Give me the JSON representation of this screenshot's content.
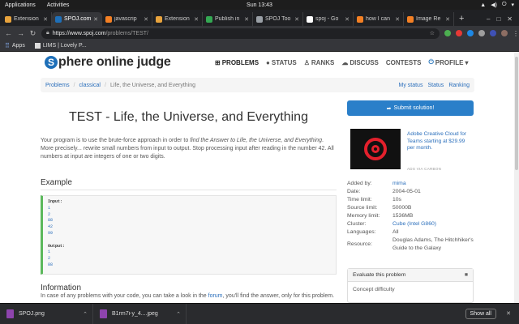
{
  "topbar": {
    "applications": "Applications",
    "activities": "Activities",
    "clock": "Sun 13:43"
  },
  "tabs": [
    {
      "title": "Extension",
      "color": "#e8a33d",
      "active": false
    },
    {
      "title": "SPOJ.com",
      "color": "#1e6fb8",
      "active": true
    },
    {
      "title": "javascrip",
      "color": "#f48024",
      "active": false
    },
    {
      "title": "Extension",
      "color": "#e8a33d",
      "active": false
    },
    {
      "title": "Publish in",
      "color": "#34a853",
      "active": false
    },
    {
      "title": "SPOJ Too",
      "color": "#9aa0a6",
      "active": false
    },
    {
      "title": "spoj - Go",
      "color": "#ffffff",
      "active": false
    },
    {
      "title": "how I can",
      "color": "#f48024",
      "active": false
    },
    {
      "title": "Image Re",
      "color": "#f48024",
      "active": false
    }
  ],
  "address": {
    "host": "https://www.spoj.com",
    "path": "/problems/TEST/"
  },
  "bookmarks": [
    {
      "label": "Apps",
      "icon": "apps-grid-icon"
    },
    {
      "label": "LIMS | Lovely P...",
      "icon": "bookmark-page-icon"
    }
  ],
  "site": {
    "logo_letter": "S",
    "logo_rest": "phere online judge",
    "nav": [
      {
        "label": "PROBLEMS",
        "icon": "sitemap-icon",
        "glyph": "⊞",
        "active": true
      },
      {
        "label": "STATUS",
        "icon": "status-circle-icon",
        "glyph": "●",
        "active": false
      },
      {
        "label": "RANKS",
        "icon": "trophy-icon",
        "glyph": "♙",
        "active": false
      },
      {
        "label": "DISCUSS",
        "icon": "comments-icon",
        "glyph": "☁",
        "active": false
      },
      {
        "label": "CONTESTS",
        "icon": "",
        "glyph": "",
        "active": false
      }
    ],
    "profile": "PROFILE"
  },
  "breadcrumb": {
    "problems": "Problems",
    "classical": "classical",
    "current": "Life, the Universe, and Everything",
    "my_status": "My status",
    "status": "Status",
    "ranking": "Ranking"
  },
  "problem": {
    "title": "TEST - Life, the Universe, and Everything",
    "desc_pre": "Your program is to use the brute-force approach in order to ",
    "desc_em": "find the Answer to Life, the Universe, and Everything",
    "desc_post": ". More precisely... rewrite small numbers from input to output. Stop processing input after reading in the number 42. All numbers at input are integers of one or two digits.",
    "example_heading": "Example",
    "input_label": "Input:",
    "input_values": [
      "1",
      "2",
      "88",
      "42",
      "99"
    ],
    "output_label": "Output:",
    "output_values": [
      "1",
      "2",
      "88"
    ],
    "info_heading": "Information",
    "info_pre": "In case of any problems with your code, you can take a look in the ",
    "info_link": "forum",
    "info_post": ", you'll find the answer, only for this problem."
  },
  "sidebar": {
    "submit_label": "Submit solution!",
    "ad_text": "Adobe Creative Cloud for Teams starting at $29.99 per month.",
    "ad_via": "ADS VIA CARBON",
    "meta": [
      {
        "key": "Added by:",
        "value": "mima",
        "link": true
      },
      {
        "key": "Date:",
        "value": "2004-05-01",
        "link": false
      },
      {
        "key": "Time limit:",
        "value": "10s",
        "link": false
      },
      {
        "key": "Source limit:",
        "value": "50000B",
        "link": false
      },
      {
        "key": "Memory limit:",
        "value": "1536MB",
        "link": false
      },
      {
        "key": "Cluster:",
        "value": "Cube (Intel G860)",
        "link": true
      },
      {
        "key": "Languages:",
        "value": "All",
        "link": false
      },
      {
        "key": "Resource:",
        "value": "Douglas Adams, The Hitchhiker's Guide to the Galaxy",
        "link": false
      }
    ],
    "evaluate_title": "Evaluate this problem",
    "concept_difficulty": "Concept difficulty"
  },
  "downloads": {
    "items": [
      {
        "name": "SPOJ.png",
        "color": "#8e44ad"
      },
      {
        "name": "B1rm7i-y_4....jpeg",
        "color": "#8e44ad"
      }
    ],
    "show_all": "Show all"
  }
}
